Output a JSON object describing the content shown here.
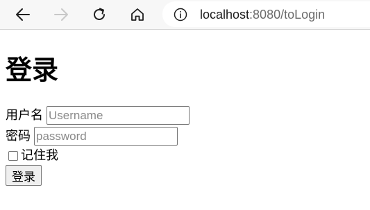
{
  "browser": {
    "back_icon": "arrow-left-icon",
    "forward_icon": "arrow-right-icon",
    "reload_icon": "reload-icon",
    "home_icon": "home-icon",
    "info_icon": "info-icon",
    "url_host": "localhost",
    "url_rest": ":8080/toLogin"
  },
  "page": {
    "title": "登录",
    "username_label": "用户名",
    "username_placeholder": "Username",
    "password_label": "密码",
    "password_placeholder": "password",
    "remember_label": "记住我",
    "remember_checked": false,
    "submit_label": "登录"
  }
}
